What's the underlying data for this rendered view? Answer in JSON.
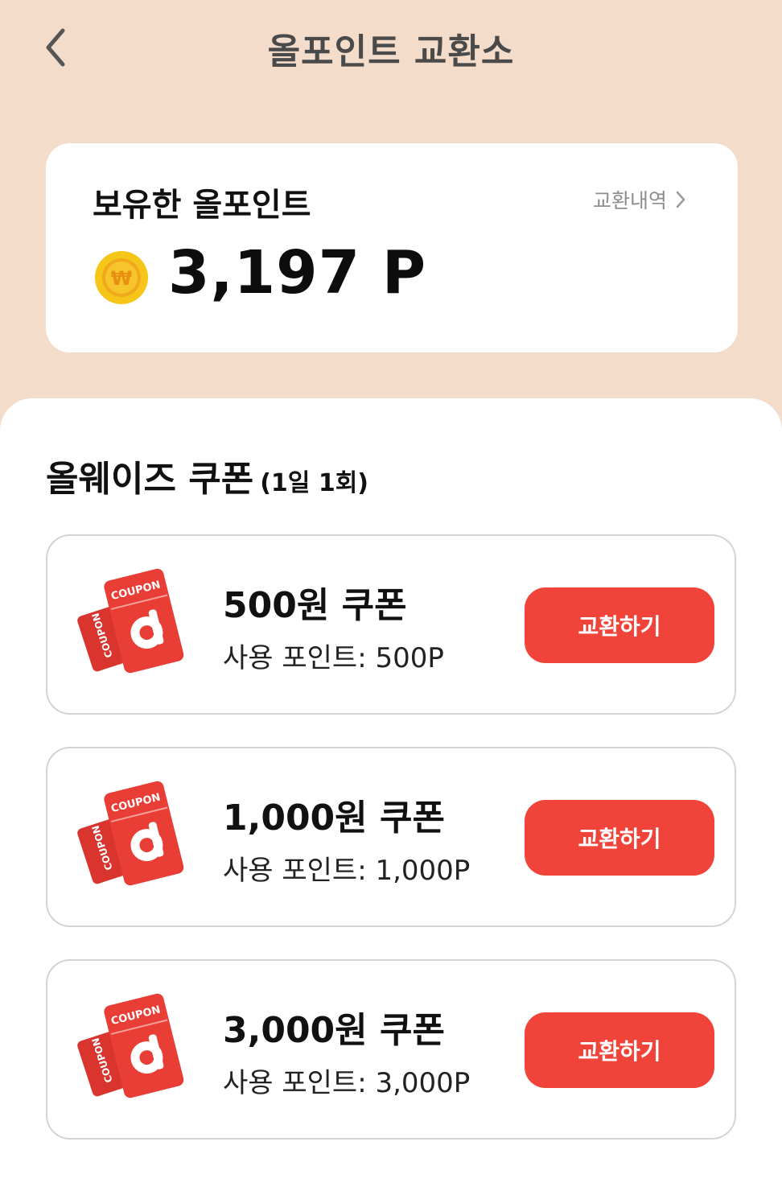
{
  "header": {
    "title": "올포인트 교환소"
  },
  "points": {
    "label": "보유한 올포인트",
    "history_link": "교환내역",
    "value": "3,197 P"
  },
  "section": {
    "title": "올웨이즈 쿠폰",
    "subtitle": "(1일 1회)"
  },
  "coupons": [
    {
      "title": "500원 쿠폰",
      "points": "사용 포인트: 500P",
      "button": "교환하기"
    },
    {
      "title": "1,000원 쿠폰",
      "points": "사용 포인트: 1,000P",
      "button": "교환하기"
    },
    {
      "title": "3,000원 쿠폰",
      "points": "사용 포인트: 3,000P",
      "button": "교환하기"
    }
  ],
  "coupon_graphic_text": "COUPON",
  "colors": {
    "background": "#f4dccb",
    "accent": "#f0433a",
    "coin": "#f5c518"
  }
}
